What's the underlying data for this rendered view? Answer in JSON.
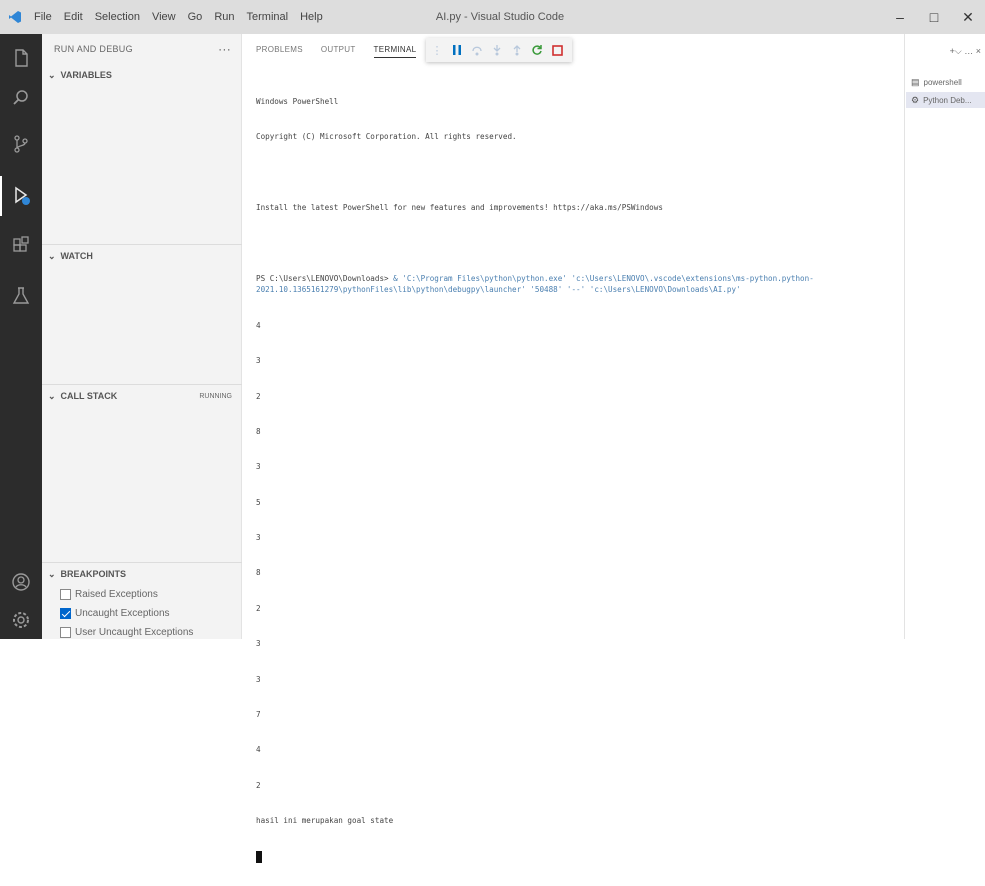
{
  "window": {
    "title": "AI.py - Visual Studio Code",
    "menu": [
      "File",
      "Edit",
      "Selection",
      "View",
      "Go",
      "Run",
      "Terminal",
      "Help"
    ],
    "controls": {
      "minimize": "–",
      "maximize": "□",
      "close": "✕"
    }
  },
  "activity_bar": {
    "items": [
      {
        "icon": "files-icon"
      },
      {
        "icon": "search-icon"
      },
      {
        "icon": "source-control-icon"
      },
      {
        "icon": "run-debug-icon",
        "active": true
      },
      {
        "icon": "extensions-icon"
      },
      {
        "icon": "testing-icon"
      }
    ],
    "bottom": [
      {
        "icon": "account-icon"
      },
      {
        "icon": "settings-gear-icon"
      }
    ]
  },
  "sidebar": {
    "title": "RUN AND DEBUG",
    "more": "···",
    "variables": "VARIABLES",
    "watch": "WATCH",
    "call_stack": "CALL STACK",
    "call_stack_status": "RUNNING",
    "breakpoints": "BREAKPOINTS",
    "breakpoint_items": [
      {
        "label": "Raised Exceptions",
        "checked": false
      },
      {
        "label": "Uncaught Exceptions",
        "checked": true
      },
      {
        "label": "User Uncaught Exceptions",
        "checked": false
      }
    ]
  },
  "panel": {
    "tabs": {
      "problems": "PROBLEMS",
      "output": "OUTPUT",
      "terminal": "TERMINAL"
    },
    "active_tab": "TERMINAL",
    "terminal": {
      "line1": "Windows PowerShell",
      "line2": "Copyright (C) Microsoft Corporation. All rights reserved.",
      "line3": "Install the latest PowerShell for new features and improvements! https://aka.ms/PSWindows",
      "prompt": "PS C:\\Users\\LENOVO\\Downloads>",
      "command": " & 'C:\\Program Files\\python\\python.exe' 'c:\\Users\\LENOVO\\.vscode\\extensions\\ms-python.python-2021.10.1365161279\\pythonFiles\\lib\\python\\debugpy\\launcher' '50488' '--' 'c:\\Users\\LENOVO\\Downloads\\AI.py'",
      "outputs": [
        "4",
        "3",
        "2",
        "8",
        "3",
        "5",
        "3",
        "8",
        "2",
        "3",
        "3",
        "7",
        "4",
        "2"
      ],
      "final": "hasil ini merupakan goal state"
    }
  },
  "terminals": {
    "items": [
      {
        "label": "powershell",
        "icon": "terminal-icon"
      },
      {
        "label": "Python Deb...",
        "icon": "debug-console-icon",
        "selected": true
      }
    ],
    "tools": "+⌵ … ×"
  }
}
